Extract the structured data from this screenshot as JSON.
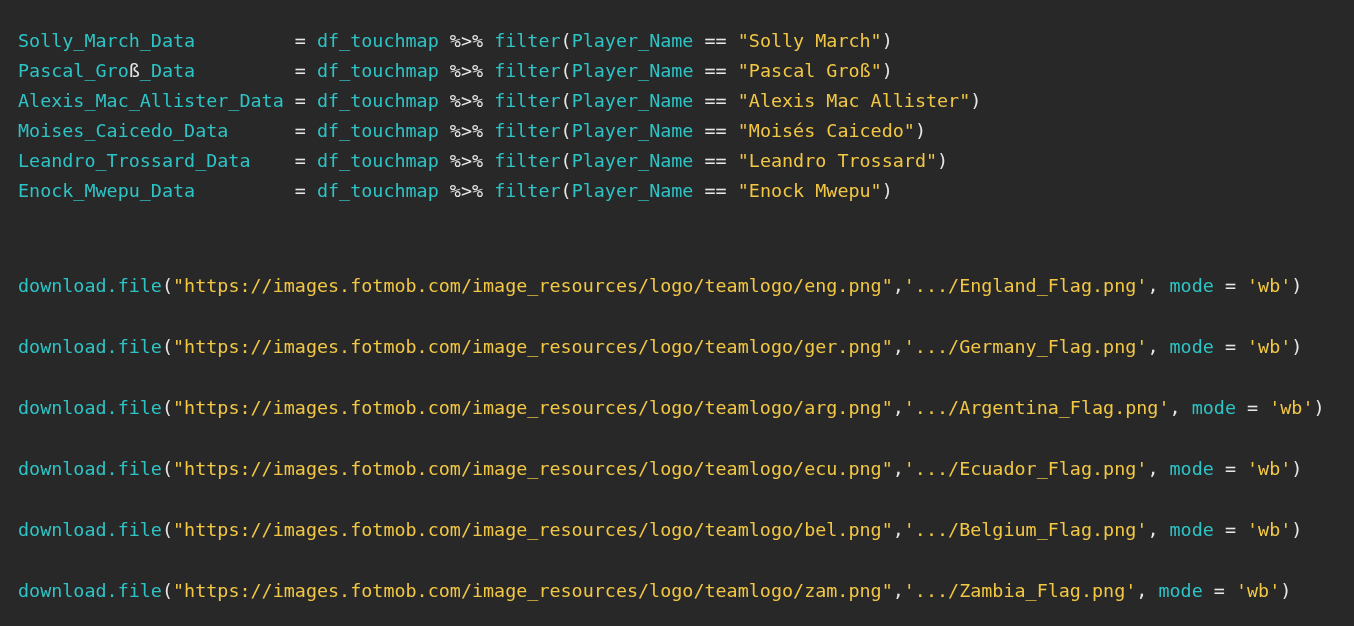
{
  "editor": {
    "blocks": [
      {
        "kind": "single",
        "lines": [
          {
            "tokens": [
              {
                "t": "Solly_March_Data",
                "kind": "id"
              },
              {
                "t": "         = ",
                "kind": "op"
              },
              {
                "t": "df_touchmap",
                "kind": "id"
              },
              {
                "t": " %>% ",
                "kind": "op"
              },
              {
                "t": "filter",
                "kind": "id"
              },
              {
                "t": "(",
                "kind": "op"
              },
              {
                "t": "Player_Name",
                "kind": "id"
              },
              {
                "t": " == ",
                "kind": "op"
              },
              {
                "t": "\"Solly March\"",
                "kind": "str"
              },
              {
                "t": ")",
                "kind": "op"
              }
            ]
          },
          {
            "tokens": [
              {
                "t": "Pascal_Gro",
                "kind": "id"
              },
              {
                "t": "ß",
                "kind": "op"
              },
              {
                "t": "_Data",
                "kind": "id"
              },
              {
                "t": "         = ",
                "kind": "op"
              },
              {
                "t": "df_touchmap",
                "kind": "id"
              },
              {
                "t": " %>% ",
                "kind": "op"
              },
              {
                "t": "filter",
                "kind": "id"
              },
              {
                "t": "(",
                "kind": "op"
              },
              {
                "t": "Player_Name",
                "kind": "id"
              },
              {
                "t": " == ",
                "kind": "op"
              },
              {
                "t": "\"Pascal Groß\"",
                "kind": "str"
              },
              {
                "t": ")",
                "kind": "op"
              }
            ]
          },
          {
            "tokens": [
              {
                "t": "Alexis_Mac_Allister_Data",
                "kind": "id"
              },
              {
                "t": " = ",
                "kind": "op"
              },
              {
                "t": "df_touchmap",
                "kind": "id"
              },
              {
                "t": " %>% ",
                "kind": "op"
              },
              {
                "t": "filter",
                "kind": "id"
              },
              {
                "t": "(",
                "kind": "op"
              },
              {
                "t": "Player_Name",
                "kind": "id"
              },
              {
                "t": " == ",
                "kind": "op"
              },
              {
                "t": "\"Alexis Mac Allister\"",
                "kind": "str"
              },
              {
                "t": ")",
                "kind": "op"
              }
            ]
          },
          {
            "tokens": [
              {
                "t": "Moises_Caicedo_Data",
                "kind": "id"
              },
              {
                "t": "      = ",
                "kind": "op"
              },
              {
                "t": "df_touchmap",
                "kind": "id"
              },
              {
                "t": " %>% ",
                "kind": "op"
              },
              {
                "t": "filter",
                "kind": "id"
              },
              {
                "t": "(",
                "kind": "op"
              },
              {
                "t": "Player_Name",
                "kind": "id"
              },
              {
                "t": " == ",
                "kind": "op"
              },
              {
                "t": "\"Moisés Caicedo\"",
                "kind": "str"
              },
              {
                "t": ")",
                "kind": "op"
              }
            ]
          },
          {
            "tokens": [
              {
                "t": "Leandro_Trossard_Data",
                "kind": "id"
              },
              {
                "t": "    = ",
                "kind": "op"
              },
              {
                "t": "df_touchmap",
                "kind": "id"
              },
              {
                "t": " %>% ",
                "kind": "op"
              },
              {
                "t": "filter",
                "kind": "id"
              },
              {
                "t": "(",
                "kind": "op"
              },
              {
                "t": "Player_Name",
                "kind": "id"
              },
              {
                "t": " == ",
                "kind": "op"
              },
              {
                "t": "\"Leandro Trossard\"",
                "kind": "str"
              },
              {
                "t": ")",
                "kind": "op"
              }
            ]
          },
          {
            "tokens": [
              {
                "t": "Enock_Mwepu_Data",
                "kind": "id"
              },
              {
                "t": "         = ",
                "kind": "op"
              },
              {
                "t": "df_touchmap",
                "kind": "id"
              },
              {
                "t": " %>% ",
                "kind": "op"
              },
              {
                "t": "filter",
                "kind": "id"
              },
              {
                "t": "(",
                "kind": "op"
              },
              {
                "t": "Player_Name",
                "kind": "id"
              },
              {
                "t": " == ",
                "kind": "op"
              },
              {
                "t": "\"Enock Mwepu\"",
                "kind": "str"
              },
              {
                "t": ")",
                "kind": "op"
              }
            ]
          }
        ]
      },
      {
        "kind": "double",
        "lines": [
          {
            "tokens": [
              {
                "t": "download.file",
                "kind": "id"
              },
              {
                "t": "(",
                "kind": "op"
              },
              {
                "t": "\"https://images.fotmob.com/image_resources/logo/teamlogo/eng.png\"",
                "kind": "str"
              },
              {
                "t": ",",
                "kind": "op"
              },
              {
                "t": "'.../England_Flag.png'",
                "kind": "str"
              },
              {
                "t": ", ",
                "kind": "op"
              },
              {
                "t": "mode",
                "kind": "id"
              },
              {
                "t": " = ",
                "kind": "op"
              },
              {
                "t": "'wb'",
                "kind": "str"
              },
              {
                "t": ")",
                "kind": "op"
              }
            ]
          },
          {
            "tokens": [
              {
                "t": "download.file",
                "kind": "id"
              },
              {
                "t": "(",
                "kind": "op"
              },
              {
                "t": "\"https://images.fotmob.com/image_resources/logo/teamlogo/ger.png\"",
                "kind": "str"
              },
              {
                "t": ",",
                "kind": "op"
              },
              {
                "t": "'.../Germany_Flag.png'",
                "kind": "str"
              },
              {
                "t": ", ",
                "kind": "op"
              },
              {
                "t": "mode",
                "kind": "id"
              },
              {
                "t": " = ",
                "kind": "op"
              },
              {
                "t": "'wb'",
                "kind": "str"
              },
              {
                "t": ")",
                "kind": "op"
              }
            ]
          },
          {
            "tokens": [
              {
                "t": "download.file",
                "kind": "id"
              },
              {
                "t": "(",
                "kind": "op"
              },
              {
                "t": "\"https://images.fotmob.com/image_resources/logo/teamlogo/arg.png\"",
                "kind": "str"
              },
              {
                "t": ",",
                "kind": "op"
              },
              {
                "t": "'.../Argentina_Flag.png'",
                "kind": "str"
              },
              {
                "t": ", ",
                "kind": "op"
              },
              {
                "t": "mode",
                "kind": "id"
              },
              {
                "t": " = ",
                "kind": "op"
              },
              {
                "t": "'wb'",
                "kind": "str"
              },
              {
                "t": ")",
                "kind": "op"
              }
            ]
          },
          {
            "tokens": [
              {
                "t": "download.file",
                "kind": "id"
              },
              {
                "t": "(",
                "kind": "op"
              },
              {
                "t": "\"https://images.fotmob.com/image_resources/logo/teamlogo/ecu.png\"",
                "kind": "str"
              },
              {
                "t": ",",
                "kind": "op"
              },
              {
                "t": "'.../Ecuador_Flag.png'",
                "kind": "str"
              },
              {
                "t": ", ",
                "kind": "op"
              },
              {
                "t": "mode",
                "kind": "id"
              },
              {
                "t": " = ",
                "kind": "op"
              },
              {
                "t": "'wb'",
                "kind": "str"
              },
              {
                "t": ")",
                "kind": "op"
              }
            ]
          },
          {
            "tokens": [
              {
                "t": "download.file",
                "kind": "id"
              },
              {
                "t": "(",
                "kind": "op"
              },
              {
                "t": "\"https://images.fotmob.com/image_resources/logo/teamlogo/bel.png\"",
                "kind": "str"
              },
              {
                "t": ",",
                "kind": "op"
              },
              {
                "t": "'.../Belgium_Flag.png'",
                "kind": "str"
              },
              {
                "t": ", ",
                "kind": "op"
              },
              {
                "t": "mode",
                "kind": "id"
              },
              {
                "t": " = ",
                "kind": "op"
              },
              {
                "t": "'wb'",
                "kind": "str"
              },
              {
                "t": ")",
                "kind": "op"
              }
            ]
          },
          {
            "tokens": [
              {
                "t": "download.file",
                "kind": "id"
              },
              {
                "t": "(",
                "kind": "op"
              },
              {
                "t": "\"https://images.fotmob.com/image_resources/logo/teamlogo/zam.png\"",
                "kind": "str"
              },
              {
                "t": ",",
                "kind": "op"
              },
              {
                "t": "'.../Zambia_Flag.png'",
                "kind": "str"
              },
              {
                "t": ", ",
                "kind": "op"
              },
              {
                "t": "mode",
                "kind": "id"
              },
              {
                "t": " = ",
                "kind": "op"
              },
              {
                "t": "'wb'",
                "kind": "str"
              },
              {
                "t": ")",
                "kind": "op"
              }
            ]
          }
        ]
      }
    ]
  }
}
